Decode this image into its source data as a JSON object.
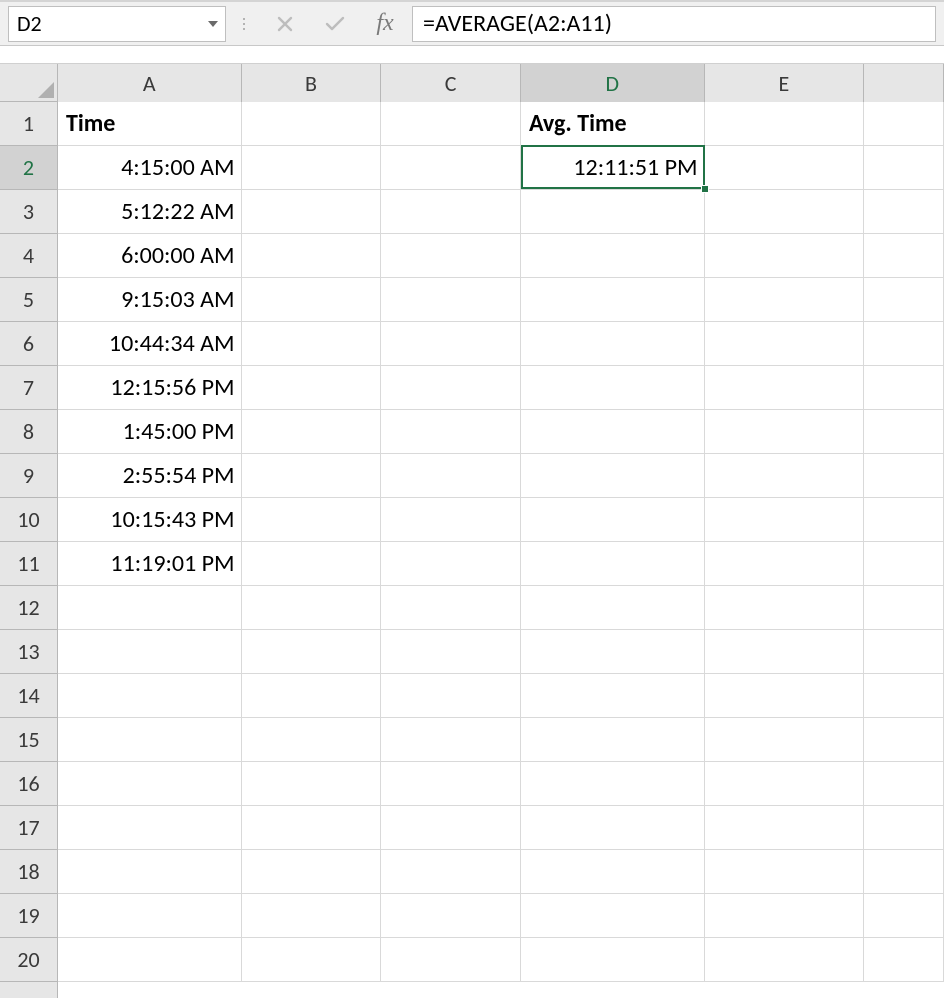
{
  "formulaBar": {
    "nameBox": "D2",
    "formula": "=AVERAGE(A2:A11)",
    "fxLabel": "fx"
  },
  "columns": [
    "A",
    "B",
    "C",
    "D",
    "E"
  ],
  "activeColumnIndex": 3,
  "activeRowIndex": 1,
  "rowCount": 20,
  "activeCell": {
    "col": "D",
    "row": 2
  },
  "cells": {
    "A1": {
      "value": "Time",
      "bold": true,
      "align": "left"
    },
    "A2": {
      "value": "4:15:00 AM",
      "bold": false,
      "align": "right"
    },
    "A3": {
      "value": "5:12:22 AM",
      "bold": false,
      "align": "right"
    },
    "A4": {
      "value": "6:00:00 AM",
      "bold": false,
      "align": "right"
    },
    "A5": {
      "value": "9:15:03 AM",
      "bold": false,
      "align": "right"
    },
    "A6": {
      "value": "10:44:34 AM",
      "bold": false,
      "align": "right"
    },
    "A7": {
      "value": "12:15:56 PM",
      "bold": false,
      "align": "right"
    },
    "A8": {
      "value": "1:45:00 PM",
      "bold": false,
      "align": "right"
    },
    "A9": {
      "value": "2:55:54 PM",
      "bold": false,
      "align": "right"
    },
    "A10": {
      "value": "10:15:43 PM",
      "bold": false,
      "align": "right"
    },
    "A11": {
      "value": "11:19:01 PM",
      "bold": false,
      "align": "right"
    },
    "D1": {
      "value": "Avg. Time",
      "bold": true,
      "align": "left"
    },
    "D2": {
      "value": "12:11:51 PM",
      "bold": false,
      "align": "right"
    }
  }
}
